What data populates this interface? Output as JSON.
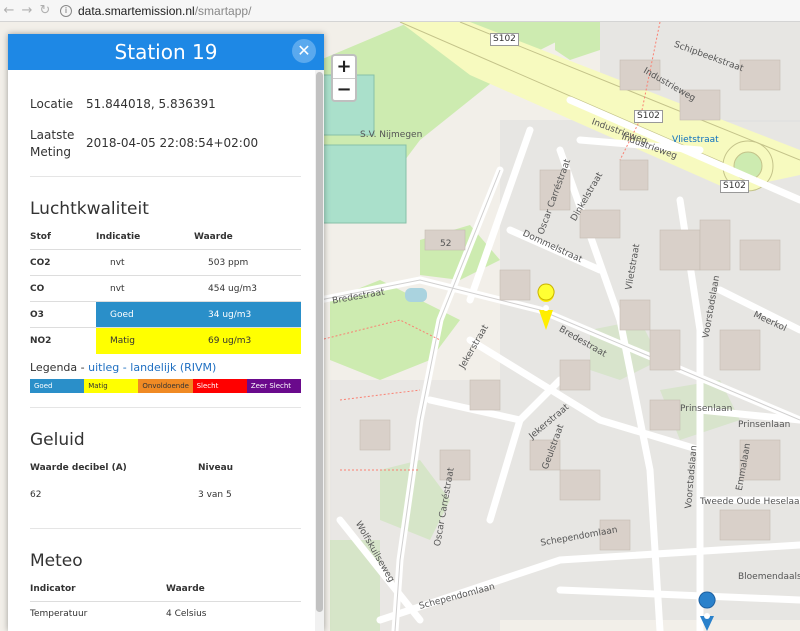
{
  "browser": {
    "back_icon": "←",
    "forward_icon": "→",
    "reload_icon": "↻",
    "url_host": "data.smartemission.nl",
    "url_path": "/smartapp/"
  },
  "map": {
    "zoom_in": "+",
    "zoom_out": "−",
    "labels": {
      "s102a": "S102",
      "s102b": "S102",
      "s102c": "S102",
      "industrieweg1": "Industrieweg",
      "industrieweg2": "Industrieweg",
      "industrieweg3": "Industrieweg",
      "schipbeekstraat": "Schipbeekstraat",
      "vlietstraat1": "Vlietstraat",
      "vlietstraat2": "Vlietstraat",
      "sv_nijmegen": "S.V. Nijmegen",
      "oscar1": "Oscar Carréstraat",
      "oscar2": "Oscar Carréstraat",
      "dinkelstraat": "Dinkelstraat",
      "dommelstraat": "Dommelstraat",
      "bredestraat1": "Bredestraat",
      "bredestraat2": "Bredestraat",
      "jekerstraat1": "Jekerstraat",
      "jekerstraat2": "Jekerstraat",
      "geulstraat": "Geulstraat",
      "voorstadslaan1": "Voorstadslaan",
      "voorstadslaan2": "Voorstadslaan",
      "meerkol": "Meerkol",
      "prinsenlaan1": "Prinsenlaan",
      "prinsenlaan2": "Prinsenlaan",
      "emmalaan": "Emmalaan",
      "tweede": "Tweede Oude Heselaan",
      "schepend1": "Schependomlaan",
      "schepend2": "Schependomlaan",
      "bloemen": "Bloemendaalseweg",
      "wolfskuil": "Wolfskuilseweg",
      "n52": "52"
    }
  },
  "panel": {
    "title": "Station 19",
    "close_icon": "✕",
    "locatie_label": "Locatie",
    "locatie_value": "51.844018, 5.836391",
    "meting_label1": "Laatste",
    "meting_label2": "Meting",
    "meting_value": "2018-04-05 22:08:54+02:00",
    "luchtkwaliteit": {
      "title": "Luchtkwaliteit",
      "headers": [
        "Stof",
        "Indicatie",
        "Waarde"
      ],
      "rows": [
        {
          "stof": "CO2",
          "indicatie": "nvt",
          "waarde": "503 ppm"
        },
        {
          "stof": "CO",
          "indicatie": "nvt",
          "waarde": "454 ug/m3"
        },
        {
          "stof": "O3",
          "indicatie": "Goed",
          "waarde": "34 ug/m3",
          "color": "#2a8fc9"
        },
        {
          "stof": "NO2",
          "indicatie": "Matig",
          "waarde": "69 ug/m3",
          "color": "#ffff00"
        }
      ],
      "legenda_label": "Legenda -",
      "legenda_link1": "uitleg",
      "legenda_sep": "-",
      "legenda_link2": "landelijk (RIVM)",
      "legend_items": [
        {
          "label": "Goed",
          "color": "#2a8fc9"
        },
        {
          "label": "Matig",
          "color": "#ffff00"
        },
        {
          "label": "Onvoldoende",
          "color": "#f08a24"
        },
        {
          "label": "Slecht",
          "color": "#ff0000"
        },
        {
          "label": "Zeer Slecht",
          "color": "#6a0a8c"
        }
      ]
    },
    "geluid": {
      "title": "Geluid",
      "headers": [
        "Waarde decibel (A)",
        "Niveau"
      ],
      "row": {
        "waarde": "62",
        "niveau": "3 van 5"
      }
    },
    "meteo": {
      "title": "Meteo",
      "headers": [
        "Indicator",
        "Waarde"
      ],
      "row": {
        "indicator": "Temperatuur",
        "waarde": "4 Celsius"
      }
    }
  }
}
